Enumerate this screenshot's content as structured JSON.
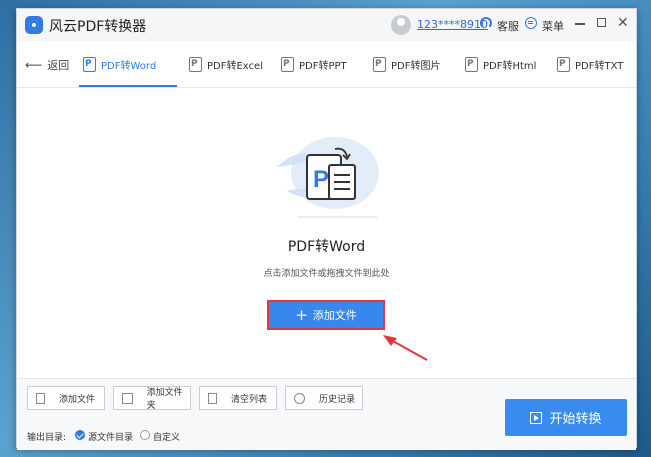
{
  "app": {
    "title": "风云PDF转换器",
    "username": "123****8910",
    "customer_service": "客服",
    "menu": "菜单",
    "brand_color": "#2f7be3"
  },
  "nav": {
    "back": "返回",
    "tabs": [
      {
        "label": "PDF转Word",
        "active": true
      },
      {
        "label": "PDF转Excel",
        "active": false
      },
      {
        "label": "PDF转PPT",
        "active": false
      },
      {
        "label": "PDF转图片",
        "active": false
      },
      {
        "label": "PDF转Html",
        "active": false
      },
      {
        "label": "PDF转TXT",
        "active": false
      }
    ]
  },
  "main": {
    "title": "PDF转Word",
    "hint": "点击添加文件或拖拽文件到此处",
    "add_file_button": "添加文件",
    "highlight_color": "#e2383b"
  },
  "bottom": {
    "tools": [
      "添加文件",
      "添加文件夹",
      "清空列表",
      "历史记录"
    ],
    "output_label": "输出目录:",
    "output_options": [
      {
        "label": "源文件目录",
        "checked": true
      },
      {
        "label": "自定义",
        "checked": false
      }
    ],
    "start_button": "开始转换"
  }
}
